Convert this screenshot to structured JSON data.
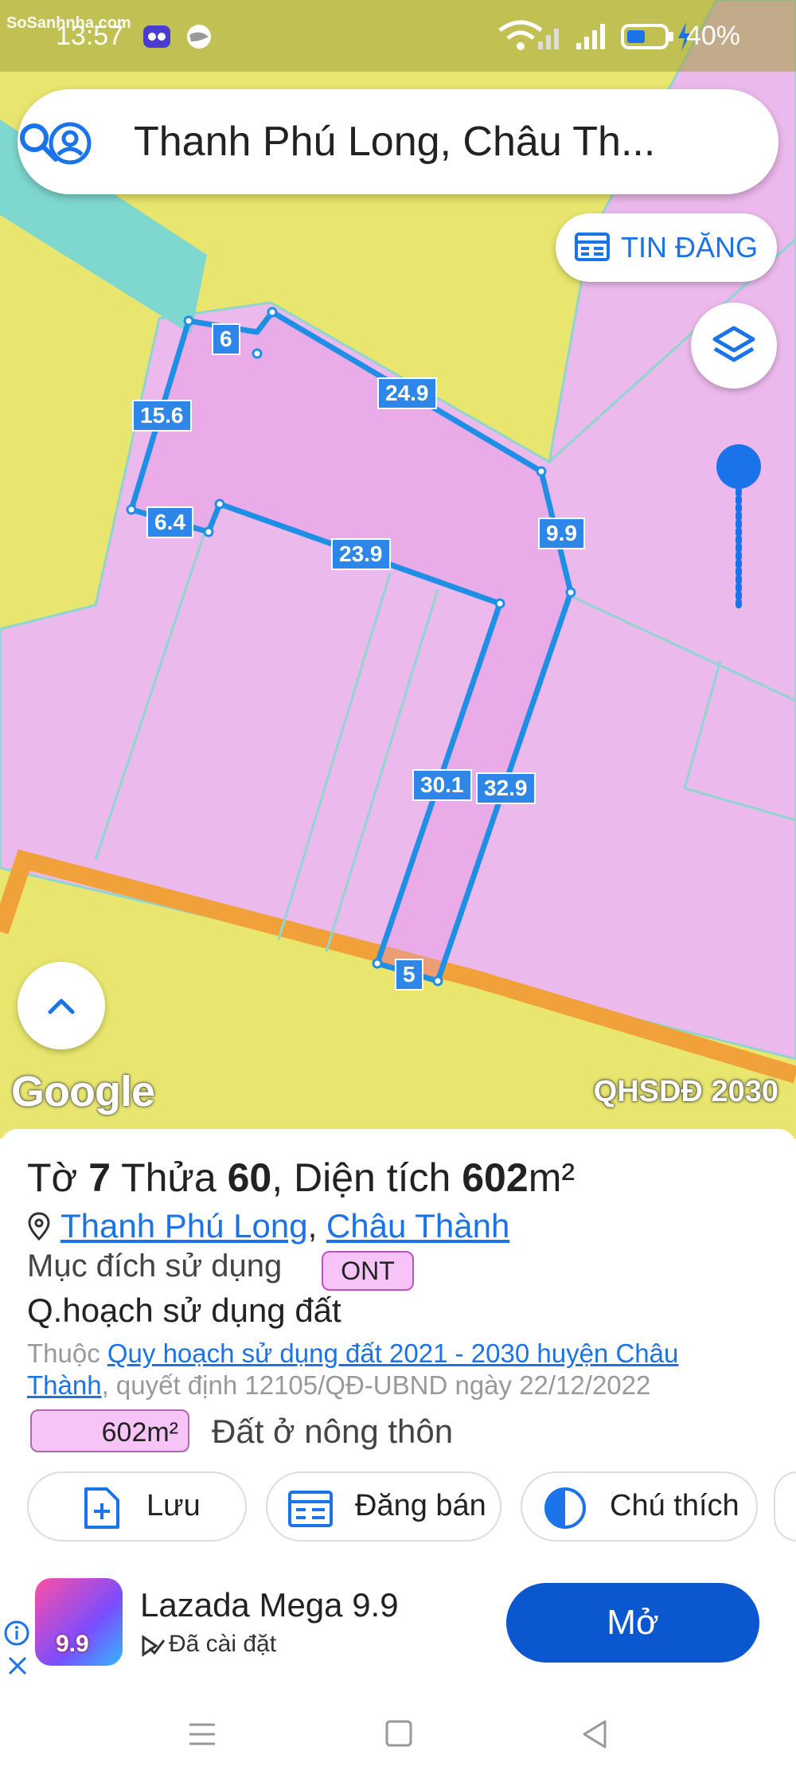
{
  "status_bar": {
    "time": "13:57",
    "watermark": "SoSanhnha.com",
    "battery": "40%"
  },
  "search": {
    "query": "Thanh Phú Long, Châu Th..."
  },
  "map": {
    "tin_dang_label": "TIN ĐĂNG",
    "google_label": "Google",
    "plan_label": "QHSDĐ 2030",
    "edge_labels": [
      "6",
      "24.9",
      "15.6",
      "9.9",
      "6.4",
      "23.9",
      "30.1",
      "32.9",
      "5"
    ]
  },
  "parcel": {
    "to_label": "Tờ",
    "to_value": "7",
    "thua_label": "Thửa",
    "thua_value": "60",
    "dien_tich_label": ", Diện tích",
    "area_value": "602",
    "area_unit": "m²",
    "ward": "Thanh Phú Long",
    "district": "Châu Thành",
    "muc_dich_label": "Mục đích sử dụng",
    "muc_dich_code": "ONT",
    "qhsd_title": "Q.hoạch sử dụng đất",
    "thuoc_label": "Thuộc",
    "plan_link": "Quy hoạch sử dụng đất 2021 - 2030 huyện Châu Thành",
    "decision_text": ", quyết định 12105/QĐ-UBND ngày 22/12/2022",
    "area_badge": "602m²",
    "land_type": "Đất ở nông thôn",
    "colors": {
      "ont_fill": "#f6c4f6",
      "ont_border": "#c44fc4",
      "accent": "#1a73e8"
    }
  },
  "actions": {
    "save": "Lưu",
    "post": "Đăng bán",
    "legend": "Chú thích"
  },
  "ad": {
    "app_name": "Lazada Mega 9.9",
    "installed": "Đã cài đặt",
    "badge": "9.9",
    "open": "Mở"
  }
}
